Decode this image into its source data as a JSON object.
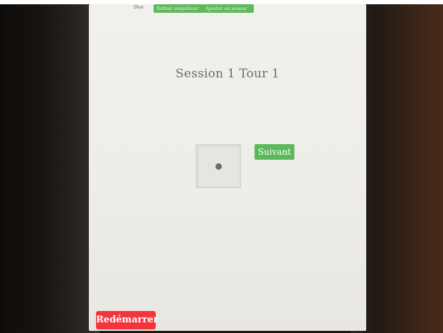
{
  "header": {
    "dice_label": "Dice",
    "define_investigator_label": "Définir enquêteur",
    "add_player_label": "Ajouter un joueur"
  },
  "session": {
    "title": "Session 1   Tour 1"
  },
  "die": {
    "face_value": 1
  },
  "actions": {
    "next_label": "Suivant",
    "restart_label": "Redémarrer"
  },
  "colors": {
    "primary_green": "#5cb85c",
    "danger_red": "#f3363e",
    "screen_bg": "#f0efea"
  }
}
